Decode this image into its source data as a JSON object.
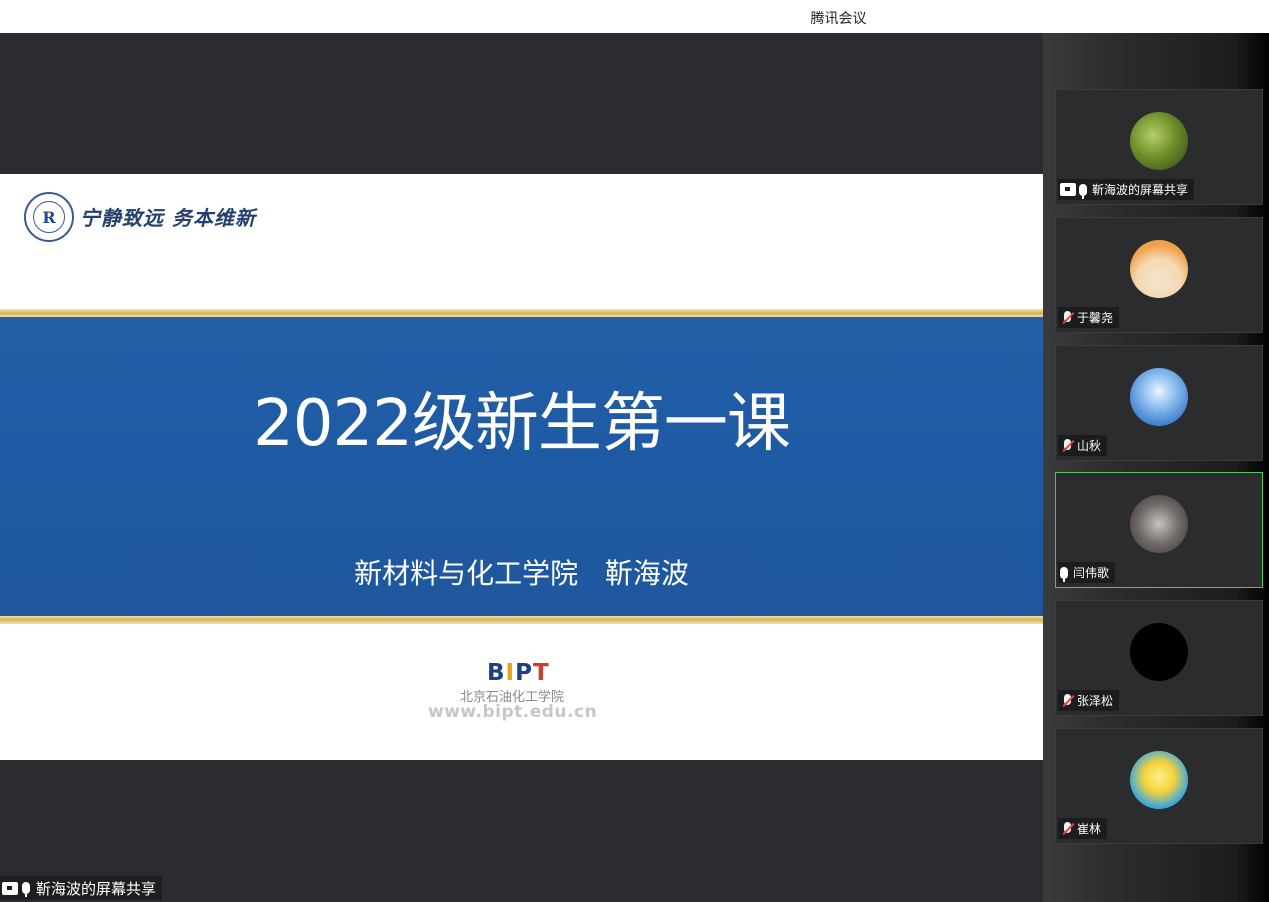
{
  "app": {
    "title": "腾讯会议"
  },
  "slide": {
    "motto": "宁静致远 务本维新",
    "logo_letter": "R",
    "title": "2022级新生第一课",
    "subtitle": "新材料与化工学院   靳海波",
    "brand": {
      "b": "B",
      "i": "I",
      "p": "P",
      "t": "T"
    },
    "school": "北京石油化工学院",
    "url": "www.bipt.edu.cn"
  },
  "screen_share": {
    "label": "靳海波的屏幕共享"
  },
  "participants": [
    {
      "name": "靳海波的屏幕共享",
      "avatar": "plant-avatar",
      "mic": "on",
      "screen": true
    },
    {
      "name": "于馨尧",
      "avatar": "cat-avatar",
      "mic": "off"
    },
    {
      "name": "山秋",
      "avatar": "blue-figure-avatar",
      "mic": "off"
    },
    {
      "name": "闫伟歌",
      "avatar": "photo-avatar",
      "mic": "on",
      "active": true
    },
    {
      "name": "张泽松",
      "avatar": "black-avatar",
      "mic": "off"
    },
    {
      "name": "崔林",
      "avatar": "yellow-face-avatar",
      "mic": "off"
    }
  ]
}
